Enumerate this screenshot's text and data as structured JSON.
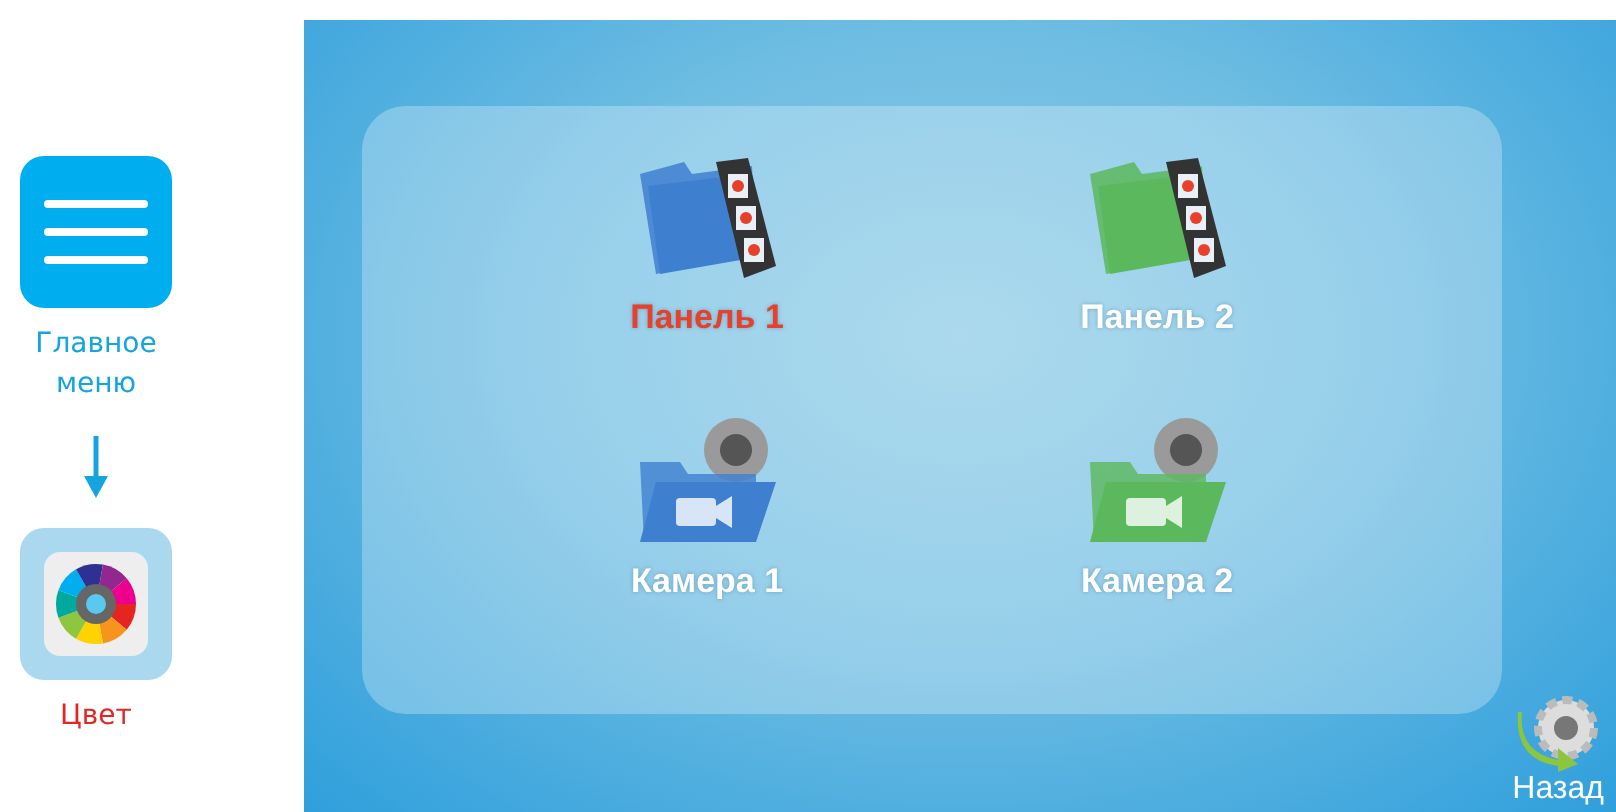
{
  "steps": [
    {
      "kind": "menu",
      "label_lines": [
        "Главное",
        "меню"
      ],
      "highlighted": false
    },
    {
      "kind": "palette",
      "label_lines": [
        "Цвет"
      ],
      "highlighted": true
    }
  ],
  "screen": {
    "items": [
      {
        "kind": "film",
        "label": "Панель 1",
        "color": "#3f7fd0",
        "selected": true
      },
      {
        "kind": "film",
        "label": "Панель 2",
        "color": "#5cb85c",
        "selected": false
      },
      {
        "kind": "camera",
        "label": "Камера 1",
        "color": "#3f7fd0",
        "selected": false
      },
      {
        "kind": "camera",
        "label": "Камера 2",
        "color": "#5cb85c",
        "selected": false
      }
    ],
    "back_button": {
      "label": "Назад"
    }
  }
}
